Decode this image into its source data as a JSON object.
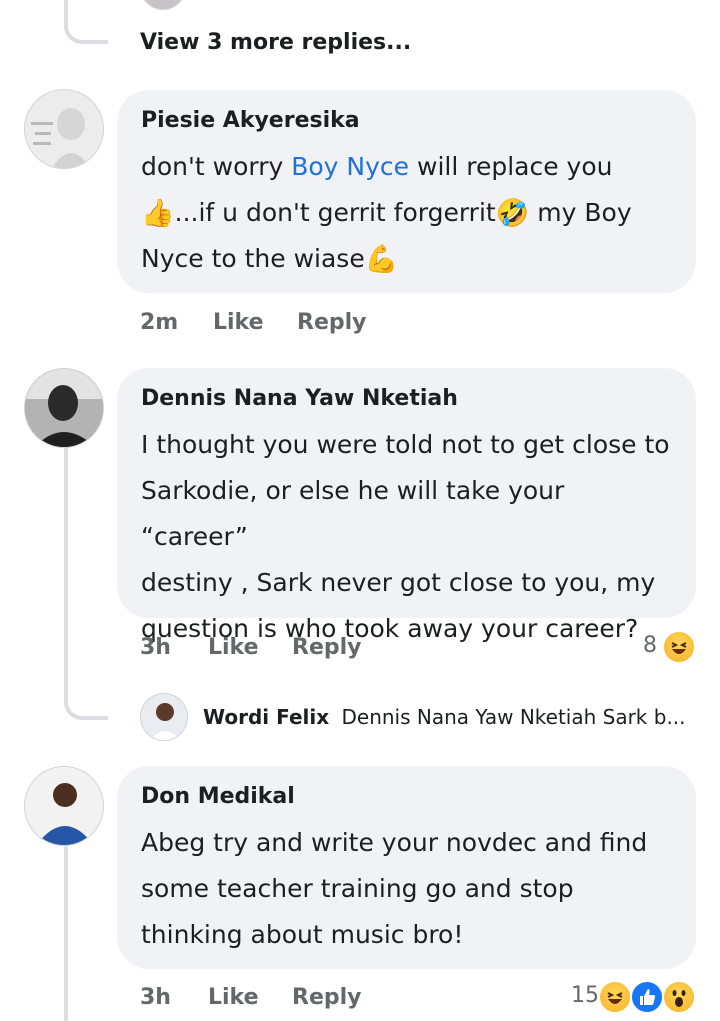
{
  "top": {
    "view_more": "View 3 more replies..."
  },
  "comments": [
    {
      "author": "Piesie Akyeresika",
      "line1_pre": "don't worry ",
      "line1_mention": "Boy Nyce",
      "line1_post": "  will replace you",
      "line2_emoji_a": "👍",
      "line2_text": "...if u don't gerrit forgerrit",
      "line2_emoji_b": "🤣",
      "line2_post": " my Boy",
      "line3_text": "Nyce to the wiase",
      "line3_emoji": "💪",
      "time": "2m",
      "like": "Like",
      "reply": "Reply"
    },
    {
      "author": "Dennis Nana Yaw Nketiah",
      "lines": [
        "I thought you were told not to get close to",
        "Sarkodie, or else he will take your “career”",
        "destiny , Sark never got close to you, my",
        "question is who took away your career?"
      ],
      "time": "3h",
      "like": "Like",
      "reply": "Reply",
      "reaction_count": "8",
      "reply_preview": {
        "author": "Wordi Felix",
        "text": "Dennis Nana Yaw Nketiah Sark b..."
      }
    },
    {
      "author": "Don Medikal",
      "lines": [
        "Abeg try and write your novdec and find",
        "some teacher training go and stop",
        "thinking about music bro!"
      ],
      "time": "3h",
      "like": "Like",
      "reply": "Reply",
      "reaction_count": "15"
    }
  ],
  "colors": {
    "bubble": "#f0f2f5",
    "mention": "#216fdb",
    "meta": "#65676b",
    "like_blue": "#1877f2"
  }
}
